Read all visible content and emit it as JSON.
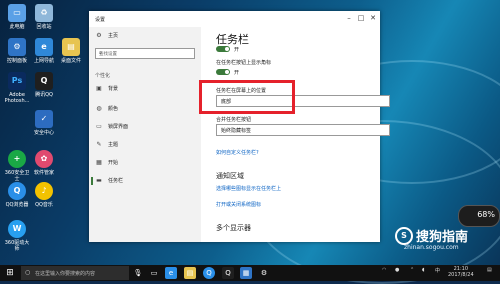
{
  "desktop": {
    "icons": [
      {
        "label": "此电脑",
        "icon": "computer-icon",
        "color": "#5aa0e6",
        "glyph": "▭"
      },
      {
        "label": "回收站",
        "icon": "recycle-bin-icon",
        "color": "#8fb7d9",
        "glyph": "♻"
      },
      {
        "label": "Adobe Photosh...",
        "icon": "photoshop-icon",
        "color": "#0a2a5e",
        "glyph": "Ps"
      },
      {
        "label": "控制面板",
        "icon": "control-panel-icon",
        "color": "#2f74c6",
        "glyph": "⚙"
      },
      {
        "label": "360安全卫士",
        "icon": "security-icon",
        "color": "#1aa845",
        "glyph": "+"
      },
      {
        "label": "QQ浏览器",
        "icon": "browser-icon",
        "color": "#2a8fe8",
        "glyph": "Q"
      },
      {
        "label": "360驱动大师",
        "icon": "driver-icon",
        "color": "#28a0f0",
        "glyph": "W"
      },
      {
        "label": "桌面文件",
        "icon": "folder-icon",
        "color": "#e7c450",
        "glyph": "▤"
      },
      {
        "label": "上网导航",
        "icon": "ie-icon",
        "color": "#2f88d8",
        "glyph": "e"
      },
      {
        "label": "腾讯QQ",
        "icon": "qq-icon",
        "color": "#1f1f1f",
        "glyph": "Q"
      },
      {
        "label": "软件管家",
        "icon": "software-manager-icon",
        "color": "#e04a6f",
        "glyph": "✿"
      },
      {
        "label": "QQ音乐",
        "icon": "music-icon",
        "color": "#f3c200",
        "glyph": "♪"
      },
      {
        "label": "安全中心",
        "icon": "shield-icon",
        "color": "#2d6cc0",
        "glyph": "✓"
      }
    ]
  },
  "window": {
    "title": "设置",
    "nav": {
      "home": "主页",
      "search_placeholder": "查找设置",
      "section": "个性化",
      "items": [
        {
          "label": "背景",
          "icon": "picture-icon",
          "glyph": "▣"
        },
        {
          "label": "颜色",
          "icon": "palette-icon",
          "glyph": "◍"
        },
        {
          "label": "锁屏界面",
          "icon": "lock-screen-icon",
          "glyph": "▭"
        },
        {
          "label": "主题",
          "icon": "theme-icon",
          "glyph": "✎"
        },
        {
          "label": "开始",
          "icon": "start-icon",
          "glyph": "▦"
        },
        {
          "label": "任务栏",
          "icon": "taskbar-icon",
          "glyph": "▬"
        }
      ]
    },
    "content": {
      "heading": "任务栏",
      "toggle1_state": "开",
      "toggle2_label": "在任务栏按钮上显示角标",
      "toggle2_state": "开",
      "position_label": "任务栏在屏幕上的位置",
      "position_value": "底部",
      "combine_label": "合并任务栏按钮",
      "combine_value": "始终隐藏标签",
      "link_customize": "如何自定义任务栏?",
      "notify_heading": "通知区域",
      "link_select_icons": "选择哪些图标显示在任务栏上",
      "link_system_icons": "打开或关闭系统图标",
      "multi_display": "多个显示器"
    }
  },
  "taskbar": {
    "search_placeholder": "在这里输入你要搜索的内容",
    "time": "21:10",
    "date": "2017/8/24",
    "ime": "中"
  },
  "watermark": {
    "brand": "搜狗指南",
    "url": "zhinan.sogou.com"
  },
  "meter": {
    "percent": "68%"
  },
  "colors": {
    "accent": "#3b7a3b",
    "highlight": "#e5212b",
    "link": "#0b63c4"
  }
}
